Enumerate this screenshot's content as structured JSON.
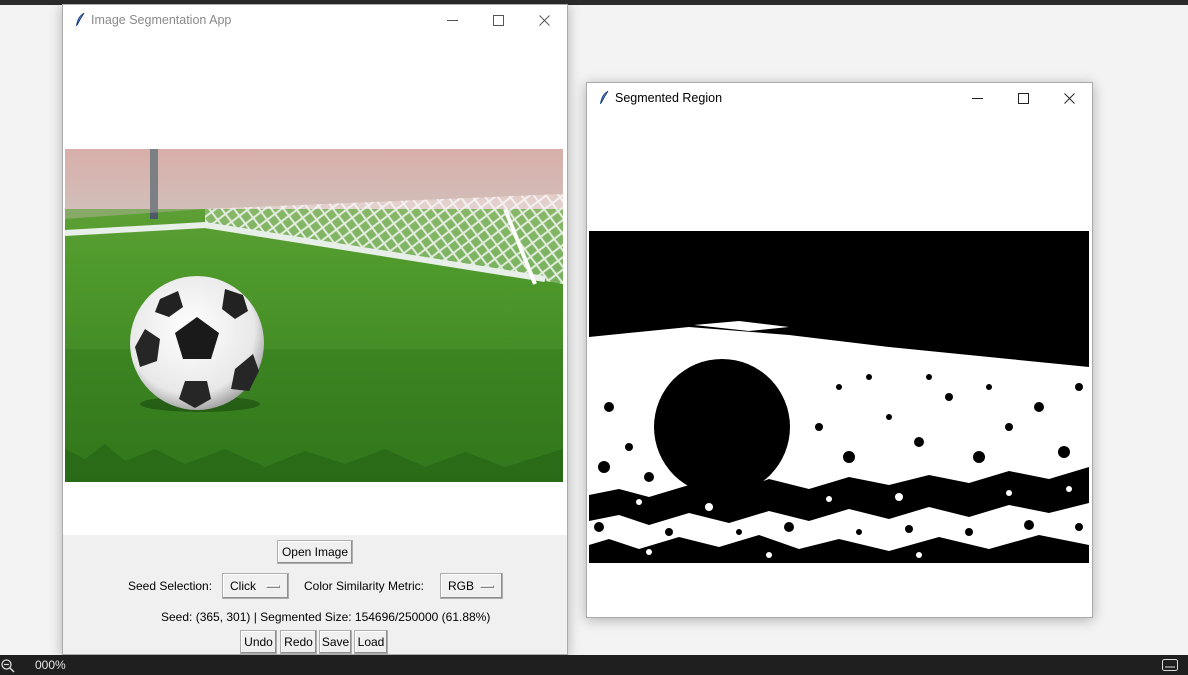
{
  "main_window": {
    "title": "Image Segmentation App",
    "open_button": "Open Image",
    "seed_label": "Seed Selection:",
    "seed_value": "Click",
    "metric_label": "Color Similarity Metric:",
    "metric_value": "RGB",
    "status": "Seed: (365, 301) |  Segmented Size: 154696/250000 (61.88%)",
    "undo": "Undo",
    "redo": "Redo",
    "save": "Save",
    "load": "Load",
    "image_icon_name": "soccer-ball-photo"
  },
  "result_window": {
    "title": "Segmented Region",
    "image_icon_name": "binary-mask"
  },
  "window_controls": [
    "minimize-icon",
    "maximize-icon",
    "close-icon"
  ],
  "app_icon": "feather-icon",
  "taskbar": {
    "zoom_text": "000%"
  },
  "colors": {
    "grass": "#3f8a25",
    "mask_black": "#000000",
    "mask_white": "#ffffff",
    "control_bg": "#f0f0f0"
  }
}
